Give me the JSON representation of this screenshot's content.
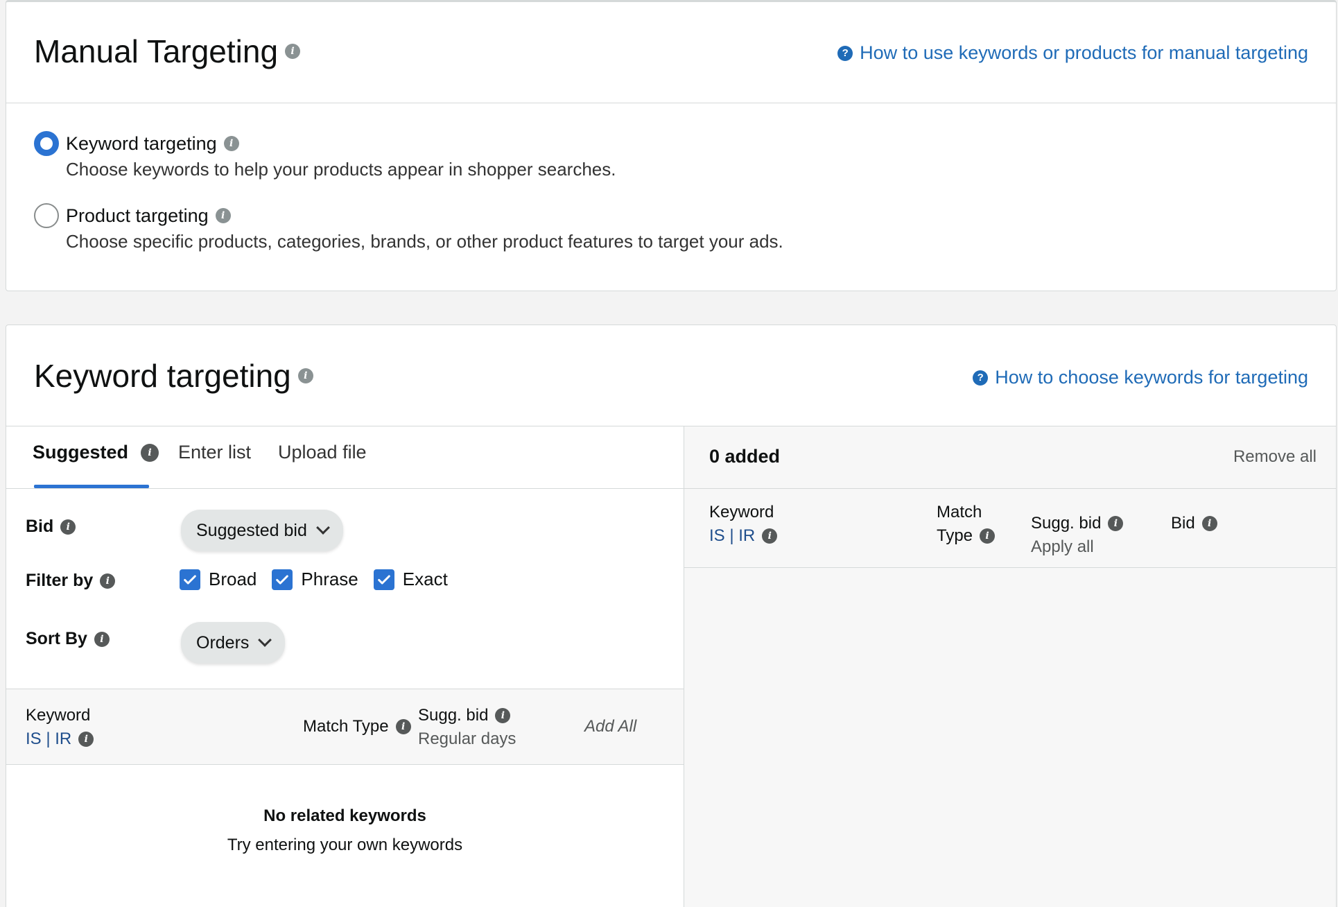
{
  "manual": {
    "title": "Manual Targeting",
    "help_link": "How to use keywords or products for manual targeting",
    "options": [
      {
        "label": "Keyword targeting",
        "desc": "Choose keywords to help your products appear in shopper searches.",
        "checked": true
      },
      {
        "label": "Product targeting",
        "desc": "Choose specific products, categories, brands, or other product features to target your ads.",
        "checked": false
      }
    ]
  },
  "keyword": {
    "title": "Keyword targeting",
    "help_link": "How to choose keywords for targeting",
    "tabs": [
      "Suggested",
      "Enter list",
      "Upload file"
    ],
    "bid_label": "Bid",
    "bid_value": "Suggested bid",
    "filter_label": "Filter by",
    "filters": [
      "Broad",
      "Phrase",
      "Exact"
    ],
    "sort_label": "Sort By",
    "sort_value": "Orders",
    "table": {
      "keyword": "Keyword",
      "keyword_sub": "IS | IR",
      "match_type": "Match Type",
      "sugg_bid": "Sugg. bid",
      "sugg_bid_sub": "Regular days",
      "add_all": "Add All"
    },
    "empty_title": "No related keywords",
    "empty_desc": "Try entering your own keywords",
    "added": {
      "count_label": "0 added",
      "remove_all": "Remove all",
      "keyword": "Keyword",
      "keyword_sub": "IS | IR",
      "match": "Match",
      "type": "Type",
      "sugg_bid": "Sugg. bid",
      "apply_all": "Apply all",
      "bid": "Bid"
    }
  },
  "colors": {
    "accent": "#2b73d2",
    "link": "#1f6bb7"
  }
}
